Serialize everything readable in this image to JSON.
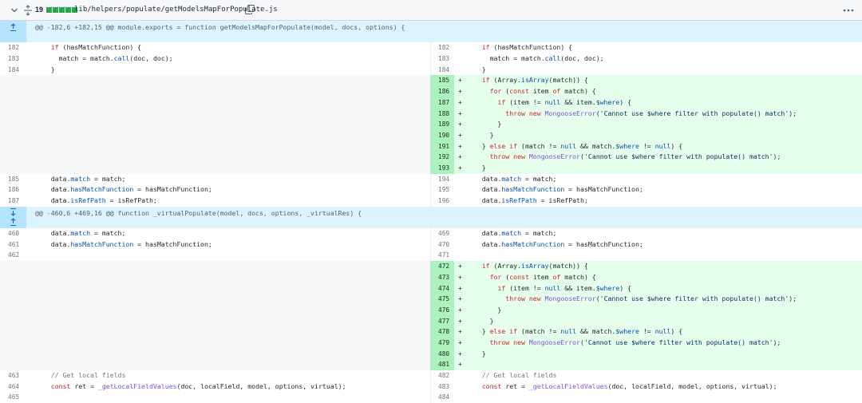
{
  "file": {
    "change_count": "19",
    "path": "lib/helpers/populate/getModelsMapForPopulate.js",
    "diffstat_blocks": 5
  },
  "colors": {
    "added_bg": "#e6ffec",
    "added_gutter": "#abf2bc",
    "hunk_bg": "#ddf4ff",
    "diffstat": "#2da44e"
  },
  "rows": [
    {
      "type": "hunk",
      "text": "@@ -182,6 +182,15 @@ module.exports = function getModelsMapForPopulate(model, docs, options) {",
      "icons": [
        "unfold-up-icon"
      ]
    },
    {
      "type": "ctx",
      "l": "182",
      "r": "182",
      "code": "    if (hasMatchFunction) {"
    },
    {
      "type": "ctx",
      "l": "183",
      "r": "183",
      "code": "      match = match.call(doc, doc);"
    },
    {
      "type": "ctx",
      "l": "184",
      "r": "184",
      "code": "    }"
    },
    {
      "type": "add",
      "r": "185",
      "code": "    if (Array.isArray(match)) {"
    },
    {
      "type": "add",
      "r": "186",
      "code": "      for (const item of match) {"
    },
    {
      "type": "add",
      "r": "187",
      "code": "        if (item != null && item.$where) {"
    },
    {
      "type": "add",
      "r": "188",
      "code": "          throw new MongooseError('Cannot use $where filter with populate() match');"
    },
    {
      "type": "add",
      "r": "189",
      "code": "        }"
    },
    {
      "type": "add",
      "r": "190",
      "code": "      }"
    },
    {
      "type": "add",
      "r": "191",
      "code": "    } else if (match != null && match.$where != null) {"
    },
    {
      "type": "add",
      "r": "192",
      "code": "      throw new MongooseError('Cannot use $where filter with populate() match');"
    },
    {
      "type": "add",
      "r": "193",
      "code": "    }"
    },
    {
      "type": "ctx",
      "l": "185",
      "r": "194",
      "code": "    data.match = match;"
    },
    {
      "type": "ctx",
      "l": "186",
      "r": "195",
      "code": "    data.hasMatchFunction = hasMatchFunction;"
    },
    {
      "type": "ctx",
      "l": "187",
      "r": "196",
      "code": "    data.isRefPath = isRefPath;"
    },
    {
      "type": "hunk",
      "text": "@@ -460,6 +469,16 @@ function _virtualPopulate(model, docs, options, _virtualRes) {",
      "icons": [
        "unfold-down-icon",
        "unfold-up-icon"
      ]
    },
    {
      "type": "ctx",
      "l": "460",
      "r": "469",
      "code": "    data.match = match;"
    },
    {
      "type": "ctx",
      "l": "461",
      "r": "470",
      "code": "    data.hasMatchFunction = hasMatchFunction;"
    },
    {
      "type": "ctx",
      "l": "462",
      "r": "471",
      "code": ""
    },
    {
      "type": "add",
      "r": "472",
      "code": "    if (Array.isArray(match)) {"
    },
    {
      "type": "add",
      "r": "473",
      "code": "      for (const item of match) {"
    },
    {
      "type": "add",
      "r": "474",
      "code": "        if (item != null && item.$where) {"
    },
    {
      "type": "add",
      "r": "475",
      "code": "          throw new MongooseError('Cannot use $where filter with populate() match');"
    },
    {
      "type": "add",
      "r": "476",
      "code": "        }"
    },
    {
      "type": "add",
      "r": "477",
      "code": "      }"
    },
    {
      "type": "add",
      "r": "478",
      "code": "    } else if (match != null && match.$where != null) {"
    },
    {
      "type": "add",
      "r": "479",
      "code": "      throw new MongooseError('Cannot use $where filter with populate() match');"
    },
    {
      "type": "add",
      "r": "480",
      "code": "    }"
    },
    {
      "type": "add",
      "r": "481",
      "code": ""
    },
    {
      "type": "ctx",
      "l": "463",
      "r": "482",
      "code": "    // Get local fields"
    },
    {
      "type": "ctx",
      "l": "464",
      "r": "483",
      "code": "    const ret = _getLocalFieldValues(doc, localField, model, options, virtual);"
    },
    {
      "type": "ctx",
      "l": "465",
      "r": "484",
      "code": ""
    }
  ]
}
